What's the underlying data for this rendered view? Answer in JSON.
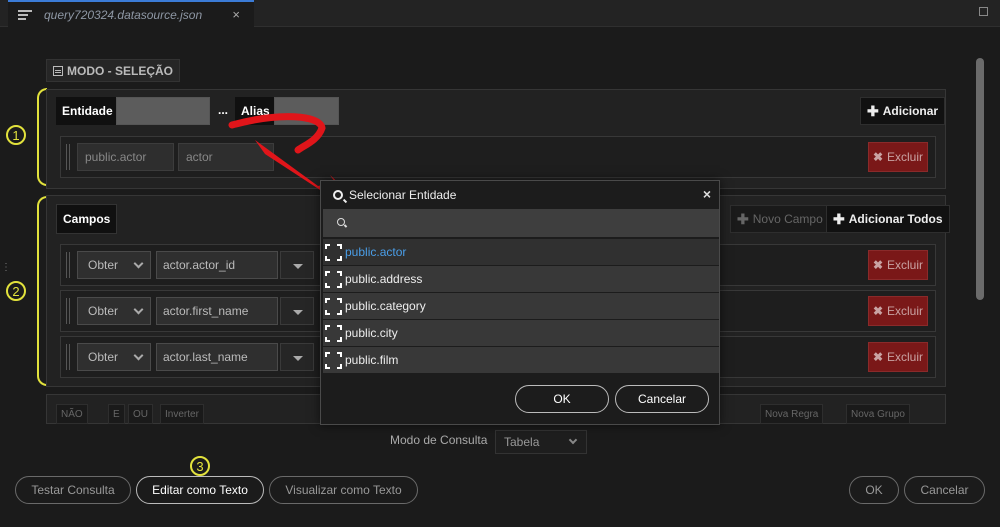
{
  "tab": {
    "title": "query720324.datasource.json",
    "close": "×"
  },
  "mode": {
    "label": "MODO - SELEÇÃO"
  },
  "markers": [
    "1",
    "2",
    "3"
  ],
  "entity_section": {
    "entity_label": "Entidade",
    "ellipsis": "...",
    "alias_label": "Alias",
    "add_button": "Adicionar",
    "row": {
      "entity": "public.actor",
      "alias": "actor",
      "delete": "Excluir"
    }
  },
  "fields_section": {
    "label": "Campos",
    "new_field": "Novo Campo",
    "add_all": "Adicionar Todos",
    "rows": [
      {
        "op": "Obter",
        "field": "actor.actor_id",
        "delete": "Excluir"
      },
      {
        "op": "Obter",
        "field": "actor.first_name",
        "delete": "Excluir"
      },
      {
        "op": "Obter",
        "field": "actor.last_name",
        "delete": "Excluir"
      }
    ]
  },
  "filter_section": {
    "not": "NÃO",
    "e": "E",
    "ou": "OU",
    "invert": "Inverter",
    "new_rule": "Nova Regra",
    "new_group": "Nova Grupo"
  },
  "query_mode": {
    "label": "Modo de Consulta",
    "value": "Tabela"
  },
  "footer": {
    "test": "Testar Consulta",
    "edit_text": "Editar como Texto",
    "view_text": "Visualizar como Texto",
    "ok": "OK",
    "cancel": "Cancelar"
  },
  "dialog": {
    "title": "Selecionar Entidade",
    "close": "×",
    "search_value": "",
    "items": [
      "public.actor",
      "public.address",
      "public.category",
      "public.city",
      "public.film"
    ],
    "selected_index": 0,
    "ok": "OK",
    "cancel": "Cancelar"
  },
  "colors": {
    "marker": "#e2e23c",
    "arrow": "#e0151a",
    "selected_item": "#4a9ee8",
    "delete_bg": "#7a1818",
    "tab_accent": "#3b7bd6"
  }
}
